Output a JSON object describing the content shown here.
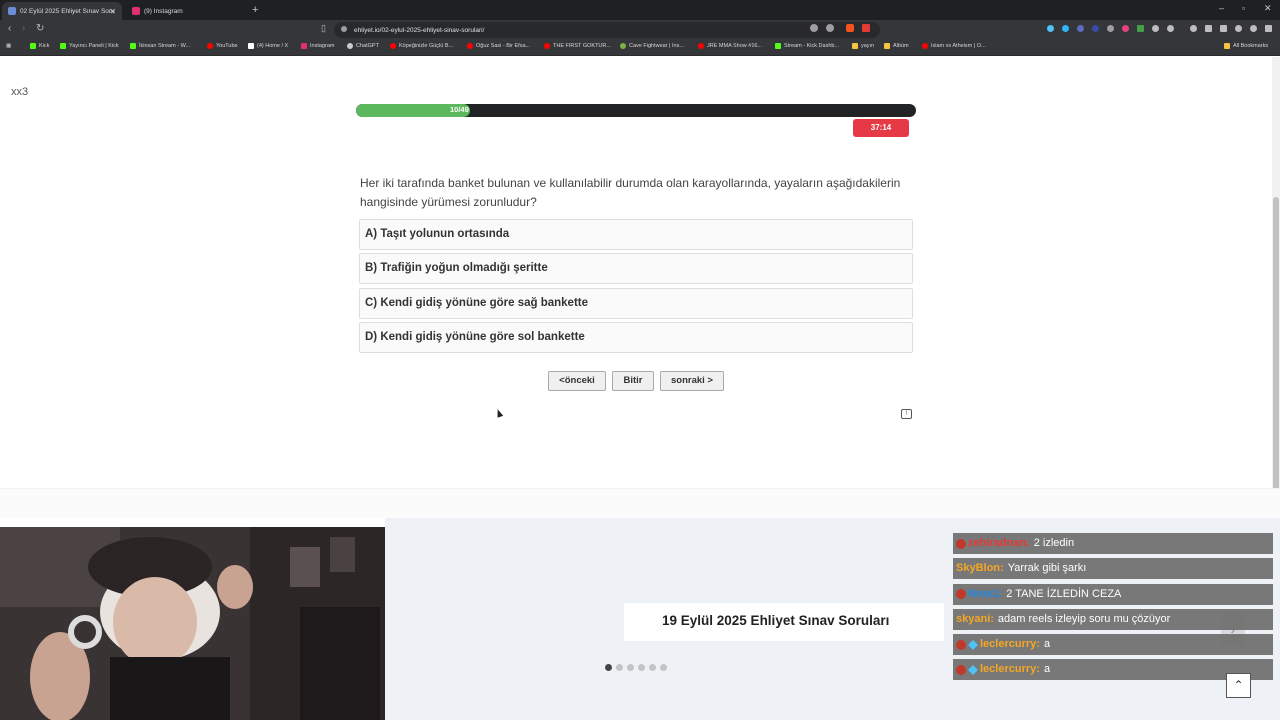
{
  "browser": {
    "tabs": [
      {
        "title": "02 Eylül 2025 Ehliyet Sınav Soru",
        "active": true
      },
      {
        "title": "(9) Instagram",
        "active": false
      }
    ],
    "new_tab": "+",
    "url": "ehliyet.io/02-eylul-2025-ehliyet-sinav-sorulari/",
    "window_controls": [
      "–",
      "▫",
      "✕"
    ],
    "bookmarks": [
      {
        "label": "Kick",
        "color": "#53fc18"
      },
      {
        "label": "Yayıncı Paneli | Kick",
        "color": "#53fc18"
      },
      {
        "label": "İkinsan Stream - W...",
        "color": "#53fc18"
      },
      {
        "label": "YouTube",
        "color": "#ff0000"
      },
      {
        "label": "(4) Home / X",
        "color": "#ffffff"
      },
      {
        "label": "Instagram",
        "color": "#e1306c"
      },
      {
        "label": "ChatGPT",
        "color": "#cccccc"
      },
      {
        "label": "Köpeğinizle Güçlü B...",
        "color": "#ff0000"
      },
      {
        "label": "Oğuz Sasi - Bir Efsa...",
        "color": "#ff0000"
      },
      {
        "label": "THE FIRST GOKTUR...",
        "color": "#ff0000"
      },
      {
        "label": "Cave Fightwear | Ins...",
        "color": "#7cb342"
      },
      {
        "label": "JRE MMA Show #16...",
        "color": "#ff0000"
      },
      {
        "label": "Stream - Kick Dashb...",
        "color": "#53fc18"
      },
      {
        "label": "yayın",
        "color": "#f5c242"
      },
      {
        "label": "Albüm",
        "color": "#f5c242"
      },
      {
        "label": "Islam vs Atheism | O...",
        "color": "#ff0000"
      }
    ],
    "all_bookmarks": "All Bookmarks"
  },
  "page": {
    "corner_label": "xx3",
    "progress": {
      "text": "10/49",
      "current": 10,
      "total": 49
    },
    "timer": "37:14",
    "question": "Her iki tarafında banket bulunan ve kullanılabilir durumda olan karayollarında, yayaların aşağıdakilerin hangisinde yürümesi zorunludur?",
    "options": [
      "A) Taşıt yolunun ortasında",
      "B) Trafiğin yoğun olmadığı şeritte",
      "C) Kendi gidiş yönüne göre sağ bankette",
      "D) Kendi gidiş yönüne göre sol bankette"
    ],
    "buttons": {
      "prev": "<önceki",
      "finish": "Bitir",
      "next": "sonraki >"
    },
    "slider": {
      "title": "19 Eylül 2025 Ehliyet Sınav Soruları",
      "dot_count": 6,
      "active_dot": 0,
      "next_arrow": "›"
    },
    "back_to_top": "⌃"
  },
  "chat": [
    {
      "user": "zehiradnan:",
      "text": "2 izledin",
      "color": "#e53935",
      "badge": "#c0392b",
      "gem": false
    },
    {
      "user": "SkyBlon:",
      "text": "Yarrak gibi şarkı",
      "color": "#f5a623",
      "badge": "",
      "gem": false
    },
    {
      "user": "Nrex1:",
      "text": "2 TANE İZLEDİN CEZA",
      "color": "#1e88e5",
      "badge": "#c0392b",
      "gem": false
    },
    {
      "user": "skyani:",
      "text": "adam reels izleyip soru mu çözüyor",
      "color": "#f5a623",
      "badge": "",
      "gem": false
    },
    {
      "user": "leclercurry:",
      "text": "a",
      "color": "#f5a623",
      "badge": "#c0392b",
      "gem": true
    },
    {
      "user": "leclercurry:",
      "text": "a",
      "color": "#f5a623",
      "badge": "#c0392b",
      "gem": true
    }
  ]
}
